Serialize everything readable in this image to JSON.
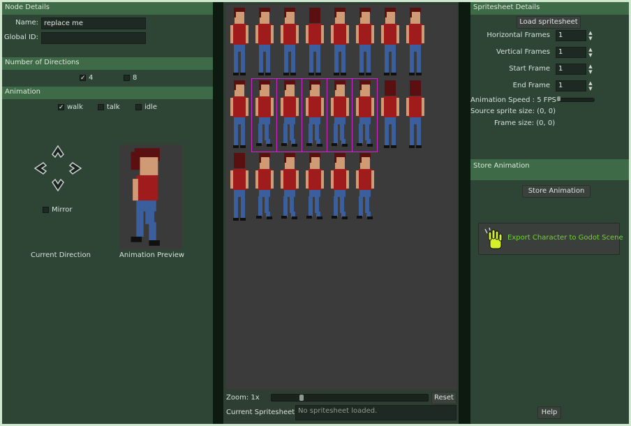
{
  "node_details": {
    "header": "Node Details",
    "name_label": "Name:",
    "name_value": "replace me",
    "global_id_label": "Global ID:",
    "global_id_value": ""
  },
  "directions": {
    "header": "Number of Directions",
    "options": [
      {
        "label": "4",
        "checked": true
      },
      {
        "label": "8",
        "checked": false
      }
    ]
  },
  "animation": {
    "header": "Animation",
    "options": [
      {
        "label": "walk",
        "checked": true
      },
      {
        "label": "talk",
        "checked": false
      },
      {
        "label": "idle",
        "checked": false
      }
    ],
    "mirror_label": "Mirror",
    "mirror_checked": false,
    "current_direction_label": "Current Direction",
    "preview_label": "Animation Preview"
  },
  "viewer": {
    "zoom_label": "Zoom: 1x",
    "reset_label": "Reset",
    "current_spritesheet_label": "Current Spritesheet:",
    "current_spritesheet_placeholder": "No spritesheet loaded."
  },
  "spritesheet": {
    "header": "Spritesheet Details",
    "load_button": "Load spritesheet",
    "horizontal_frames_label": "Horizontal Frames",
    "horizontal_frames_value": "1",
    "vertical_frames_label": "Vertical Frames",
    "vertical_frames_value": "1",
    "start_frame_label": "Start Frame",
    "start_frame_value": "1",
    "end_frame_label": "End Frame",
    "end_frame_value": "1",
    "animation_speed_label": "Animation Speed : 5 FPS",
    "source_size_label": "Source sprite size: (0, 0)",
    "frame_size_label": "Frame size: (0, 0)"
  },
  "store": {
    "header": "Store Animation",
    "button": "Store Animation",
    "export_button": "Export Character to Godot Scene",
    "help_button": "Help"
  },
  "colors": {
    "panel_bg": "#2e4536",
    "header_bg": "#3f6a47",
    "selection": "#d225d2",
    "export_text": "#6ed62c"
  }
}
